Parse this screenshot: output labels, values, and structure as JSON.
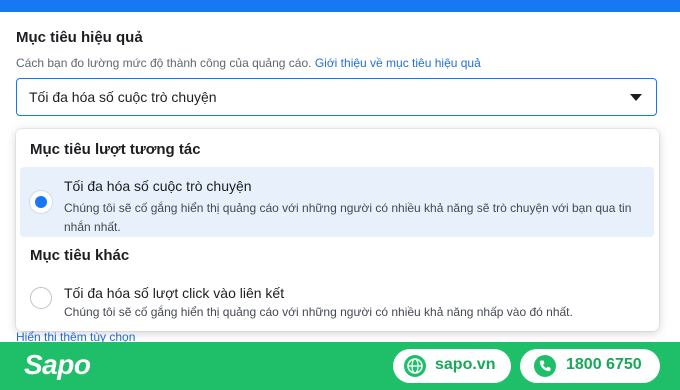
{
  "header": {
    "title": "Mục tiêu hiệu quả",
    "description": "Cách bạn đo lường mức độ thành công của quảng cáo.",
    "learn_more": "Giới thiệu về mục tiêu hiệu quả"
  },
  "select": {
    "value": "Tối đa hóa số cuộc trò chuyện",
    "icon": "caret-down-icon"
  },
  "behind_text": "Hiển thị thêm tùy chọn",
  "menu": {
    "groups": [
      {
        "title": "Mục tiêu lượt tương tác",
        "options": [
          {
            "label": "Tối đa hóa số cuộc trò chuyện",
            "desc": "Chúng tôi sẽ cố gắng hiển thị quảng cáo với những người có nhiều khả năng sẽ trò chuyện với bạn qua tin nhắn nhất.",
            "selected": true
          }
        ]
      },
      {
        "title": "Mục tiêu khác",
        "options": [
          {
            "label": "Tối đa hóa số lượt click vào liên kết",
            "desc": "Chúng tôi sẽ cố gắng hiển thị quảng cáo với những người có nhiều khả năng nhấp vào đó nhất.",
            "selected": false
          }
        ]
      }
    ]
  },
  "footer": {
    "logo": "Sapo",
    "website": "sapo.vn",
    "phone": "1800 6750",
    "colors": {
      "brand_green": "#1fbf6a",
      "facebook_blue": "#1877f2"
    }
  }
}
